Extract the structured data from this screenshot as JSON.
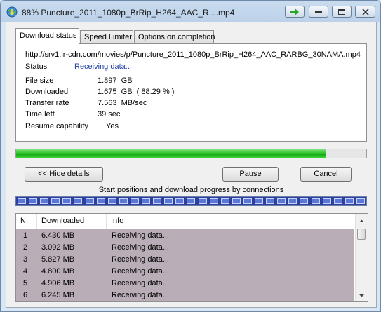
{
  "window": {
    "title": "88% Puncture_2011_1080p_BrRip_H264_AAC_R....mp4"
  },
  "tabs": [
    {
      "label": "Download status"
    },
    {
      "label": "Speed Limiter"
    },
    {
      "label": "Options on completion"
    }
  ],
  "status": {
    "url": "http://srv1.ir-cdn.com/movies/p/Puncture_2011_1080p_BrRip_H264_AAC_RARBG_30NAMA.mp4",
    "status_label": "Status",
    "status_value": "Receiving data...",
    "rows": [
      {
        "label": "File size",
        "value": "1.897  GB"
      },
      {
        "label": "Downloaded",
        "value": "1.675  GB  ( 88.29 % )"
      },
      {
        "label": "Transfer rate",
        "value": "7.563  MB/sec"
      },
      {
        "label": "Time left",
        "value": "39 sec"
      },
      {
        "label": "Resume capability",
        "value": "    Yes"
      }
    ]
  },
  "progress": {
    "fraction": 0.8829
  },
  "buttons": {
    "hide_details": "<< Hide details",
    "pause": "Pause",
    "cancel": "Cancel"
  },
  "connections": {
    "caption": "Start positions and download progress by connections",
    "segments": 31,
    "columns": [
      "N.",
      "Downloaded",
      "Info"
    ],
    "rows": [
      {
        "n": "1",
        "downloaded": "6.430  MB",
        "info": "Receiving data..."
      },
      {
        "n": "2",
        "downloaded": "3.092  MB",
        "info": "Receiving data..."
      },
      {
        "n": "3",
        "downloaded": "5.827  MB",
        "info": "Receiving data..."
      },
      {
        "n": "4",
        "downloaded": "4.800  MB",
        "info": "Receiving data..."
      },
      {
        "n": "5",
        "downloaded": "4.906  MB",
        "info": "Receiving data..."
      },
      {
        "n": "6",
        "downloaded": "6.245  MB",
        "info": "Receiving data..."
      }
    ]
  },
  "colors": {
    "progress": "#1fb41f",
    "connection_bar": "#2f3fa0",
    "list_row_bg": "#b9adb7",
    "status_text": "#1f3fa8"
  }
}
